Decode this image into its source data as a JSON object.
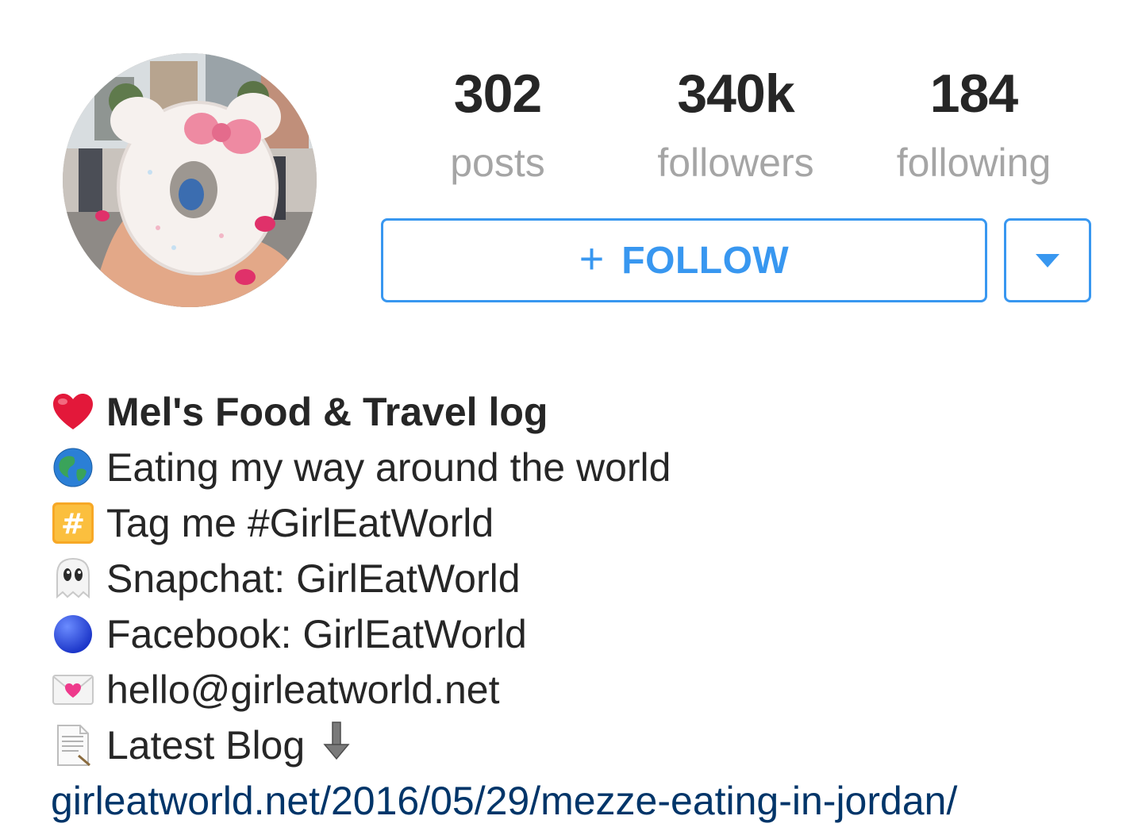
{
  "profile": {
    "avatar_icon": "profile-photo-donut"
  },
  "stats": {
    "posts": {
      "value": "302",
      "label": "posts"
    },
    "followers": {
      "value": "340k",
      "label": "followers"
    },
    "following": {
      "value": "184",
      "label": "following"
    }
  },
  "actions": {
    "follow_plus": "+",
    "follow_label": "FOLLOW",
    "dropdown_icon": "caret-down-icon",
    "accent_color": "#3897f0"
  },
  "bio": {
    "lines": [
      {
        "icon": "red-heart-icon",
        "text": "Mel's Food & Travel log"
      },
      {
        "icon": "globe-icon",
        "text": "Eating my way around the world"
      },
      {
        "icon": "hashtag-icon",
        "text": "Tag me #GirlEatWorld"
      },
      {
        "icon": "ghost-icon",
        "text": "Snapchat: GirlEatWorld"
      },
      {
        "icon": "blue-circle-icon",
        "text": "Facebook: GirlEatWorld"
      },
      {
        "icon": "love-letter-icon",
        "text": "hello@girleatworld.net"
      },
      {
        "icon": "document-icon",
        "text": "Latest Blog",
        "trailing_icon": "down-arrow-icon"
      }
    ],
    "link": "girleatworld.net/2016/05/29/mezze-eating-in-jordan/",
    "link_color": "#003569"
  }
}
